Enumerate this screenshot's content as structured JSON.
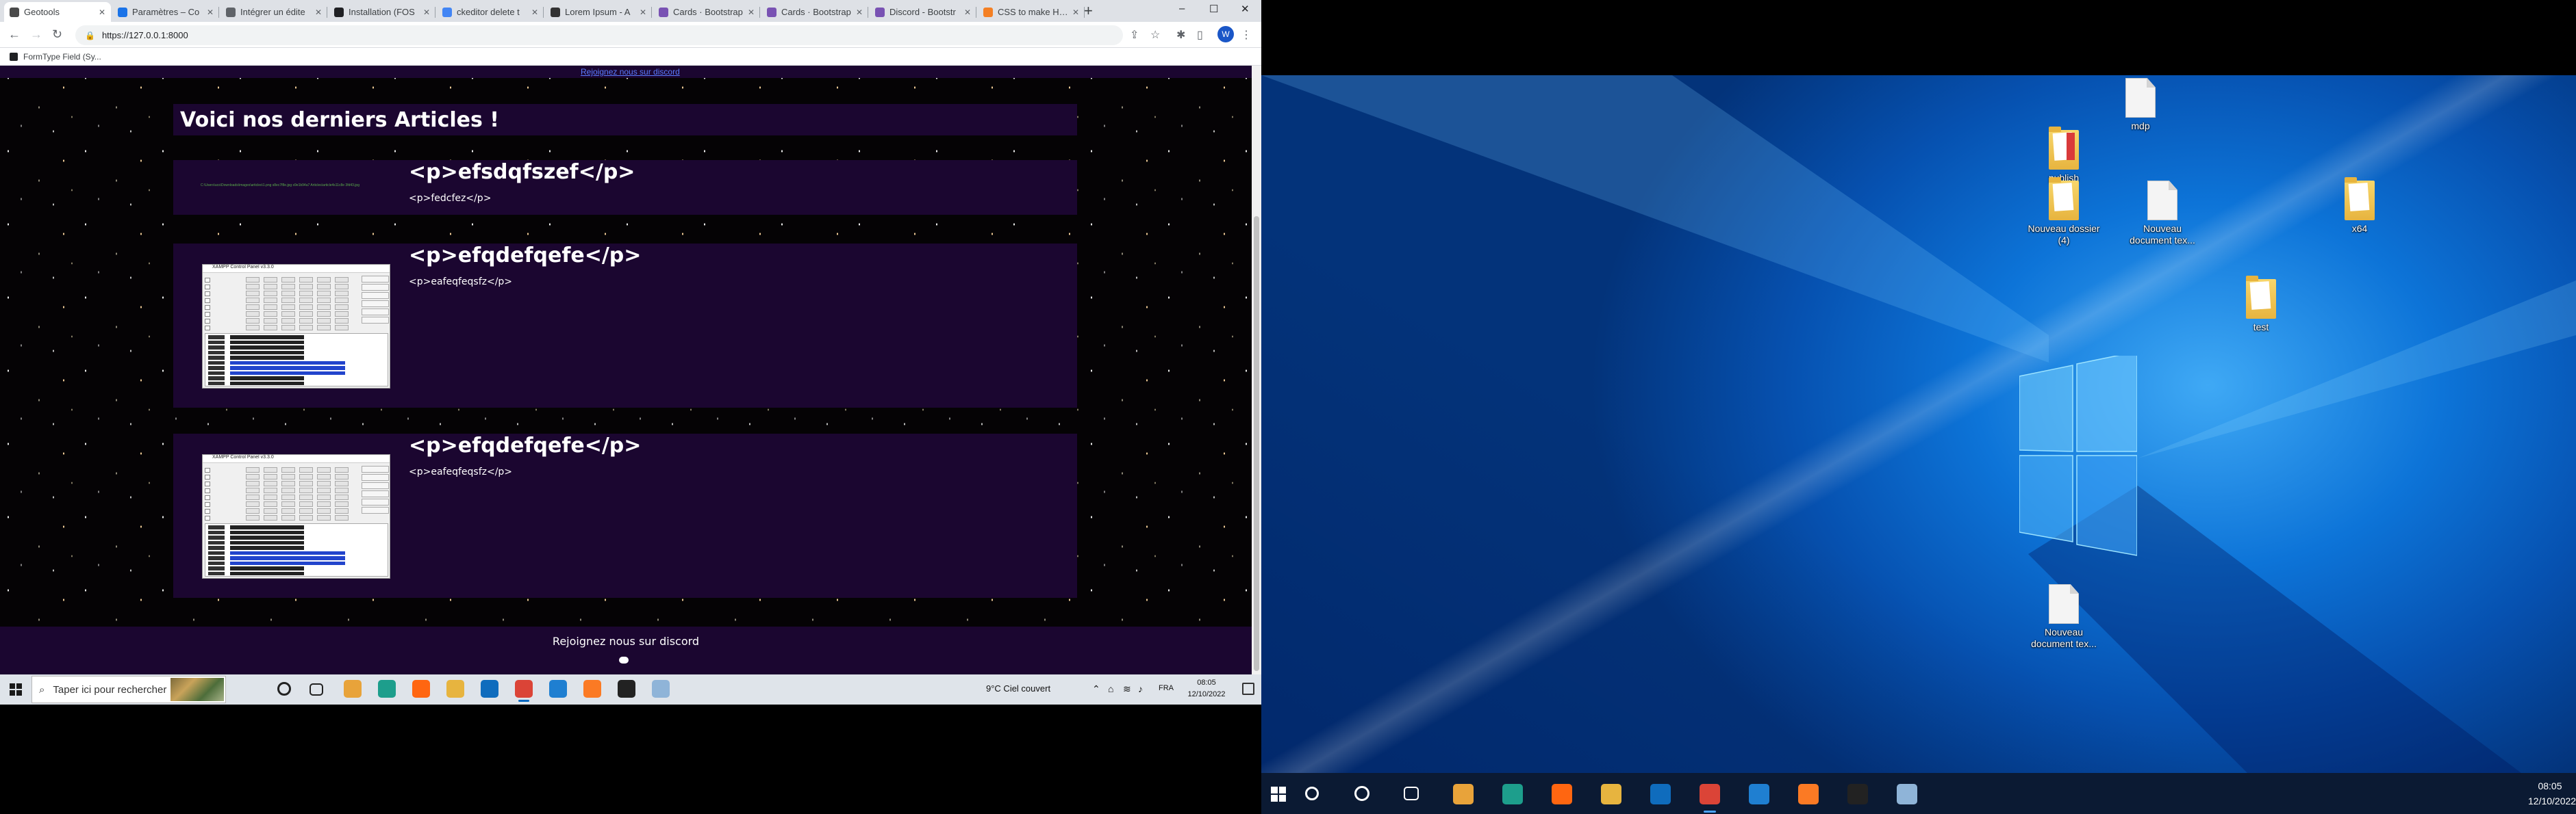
{
  "browser": {
    "tabs": [
      {
        "label": "Geotools",
        "favicon_color": "#4a4a4a",
        "active": true
      },
      {
        "label": "Paramètres – Co",
        "favicon_color": "#1a73e8"
      },
      {
        "label": "Intégrer un édite",
        "favicon_color": "#5f6368"
      },
      {
        "label": "Installation (FOS",
        "favicon_color": "#202124"
      },
      {
        "label": "ckeditor delete t",
        "favicon_color": "#4285f4"
      },
      {
        "label": "Lorem Ipsum - A",
        "favicon_color": "#333333"
      },
      {
        "label": "Cards · Bootstrap",
        "favicon_color": "#7952b3"
      },
      {
        "label": "Cards · Bootstrap",
        "favicon_color": "#7952b3"
      },
      {
        "label": "Discord - Bootstr",
        "favicon_color": "#7952b3"
      },
      {
        "label": "CSS to make HTM",
        "favicon_color": "#f48024"
      }
    ],
    "new_tab": "+",
    "window_controls": {
      "min": "‒",
      "max": "☐",
      "close": "✕"
    },
    "address": "https://127.0.0.1:8000",
    "profile_initial": "W",
    "bookmark": "FormType Field (Sy..."
  },
  "page": {
    "top_link": "Rejoignez nous sur discord",
    "heading": "Voici nos derniers Articles !",
    "cards": [
      {
        "title": "<p>efsdqfszef</p>",
        "desc": "<p>fedcfez</p>",
        "image_link_text": "C:\\Users\\ucs\\Downloads\\images\\articles\\1.png  s8ec7f8e.jpg  s9e1b94a7  Articles\\article4s11c8e 3fd43.jpg"
      },
      {
        "title": "<p>efqdefqefe</p>",
        "desc": "<p>eafeqfeqsfz</p>",
        "thumb_title": "XAMPP Control Panel v3.3.0"
      },
      {
        "title": "<p>efqdefqefe</p>",
        "desc": "<p>eafeqfeqsfz</p>",
        "thumb_title": "XAMPP Control Panel v3.3.0"
      }
    ],
    "footer_text": "Rejoignez nous sur discord"
  },
  "taskbar_left": {
    "search_placeholder": "Taper ici pour rechercher",
    "weather": "9°C  Ciel couvert",
    "lang": "FRA",
    "time": "08:05",
    "date": "12/10/2022",
    "apps": [
      {
        "name": "cortana-icon",
        "color": "#ffffff"
      },
      {
        "name": "task-view-icon",
        "color": "#ffffff"
      },
      {
        "name": "store-icon",
        "color": "#e8a33a"
      },
      {
        "name": "edge-icon",
        "color": "#1d9e8c"
      },
      {
        "name": "firefox-icon",
        "color": "#ff6611"
      },
      {
        "name": "explorer-icon",
        "color": "#e7b43f"
      },
      {
        "name": "mail-icon",
        "color": "#0f6cbd"
      },
      {
        "name": "chrome-icon",
        "color": "#db4437",
        "running": true
      },
      {
        "name": "vscode-icon",
        "color": "#1f7fd1"
      },
      {
        "name": "xampp-icon",
        "color": "#fb7a24"
      },
      {
        "name": "terminal-icon",
        "color": "#222222"
      },
      {
        "name": "wsl-icon",
        "color": "#8fb4d8"
      }
    ]
  },
  "desktop": {
    "icons": [
      {
        "label": "mdp",
        "kind": "doc"
      },
      {
        "label": "publish",
        "kind": "folder-red"
      },
      {
        "label": "Nouveau dossier (4)",
        "kind": "folder"
      },
      {
        "label": "Nouveau document tex...",
        "kind": "doc"
      },
      {
        "label": "x64",
        "kind": "folder"
      },
      {
        "label": "test",
        "kind": "folder"
      },
      {
        "label": "Nouveau document tex...",
        "kind": "doc"
      }
    ]
  },
  "taskbar_right": {
    "time": "08:05",
    "date": "12/10/2022",
    "apps": [
      {
        "name": "search-icon",
        "color": "#ffffff"
      },
      {
        "name": "cortana-icon",
        "color": "#ffffff"
      },
      {
        "name": "task-view-icon",
        "color": "#ffffff"
      },
      {
        "name": "store-icon",
        "color": "#e8a33a"
      },
      {
        "name": "edge-icon",
        "color": "#1d9e8c"
      },
      {
        "name": "firefox-icon",
        "color": "#ff6611"
      },
      {
        "name": "explorer-icon",
        "color": "#e7b43f"
      },
      {
        "name": "mail-icon",
        "color": "#0f6cbd"
      },
      {
        "name": "chrome-icon",
        "color": "#db4437",
        "running": true
      },
      {
        "name": "vscode-icon",
        "color": "#1f7fd1"
      },
      {
        "name": "xampp-icon",
        "color": "#fb7a24"
      },
      {
        "name": "terminal-icon",
        "color": "#222222"
      },
      {
        "name": "wsl-icon",
        "color": "#8fb4d8"
      }
    ]
  }
}
